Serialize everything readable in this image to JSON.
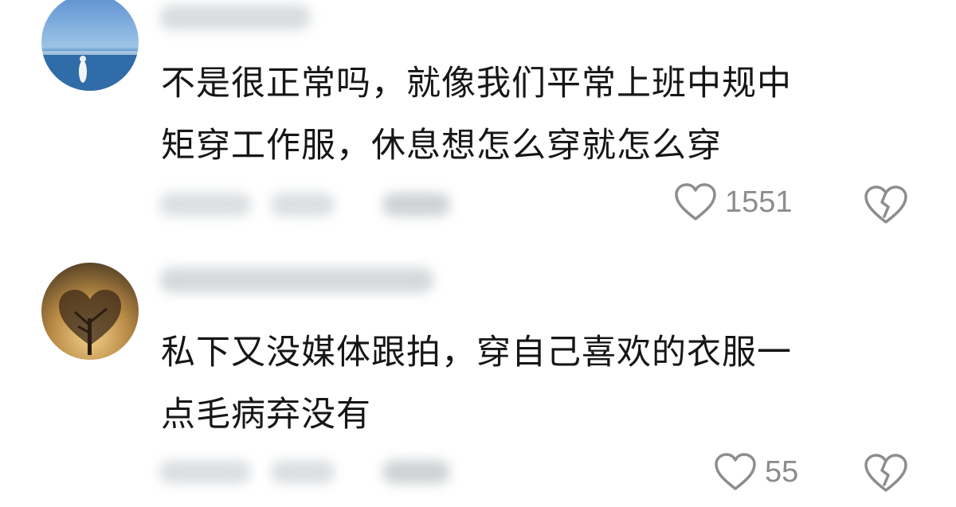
{
  "comments": [
    {
      "text_lines": [
        "不是很正常吗，就像我们平常上班中规中",
        "矩穿工作服，休息想怎么穿就怎么穿"
      ],
      "like_count": "1551",
      "like_icon": "heart-outline-icon",
      "dislike_icon": "broken-heart-icon"
    },
    {
      "text_lines": [
        "私下又没媒体跟拍，穿自己喜欢的衣服一",
        "点毛病弃没有"
      ],
      "like_count": "55",
      "like_icon": "heart-outline-icon",
      "dislike_icon": "broken-heart-icon"
    }
  ],
  "colors": {
    "text": "#161616",
    "icon": "#8d8d8d",
    "blurred": "#d9dde0"
  }
}
